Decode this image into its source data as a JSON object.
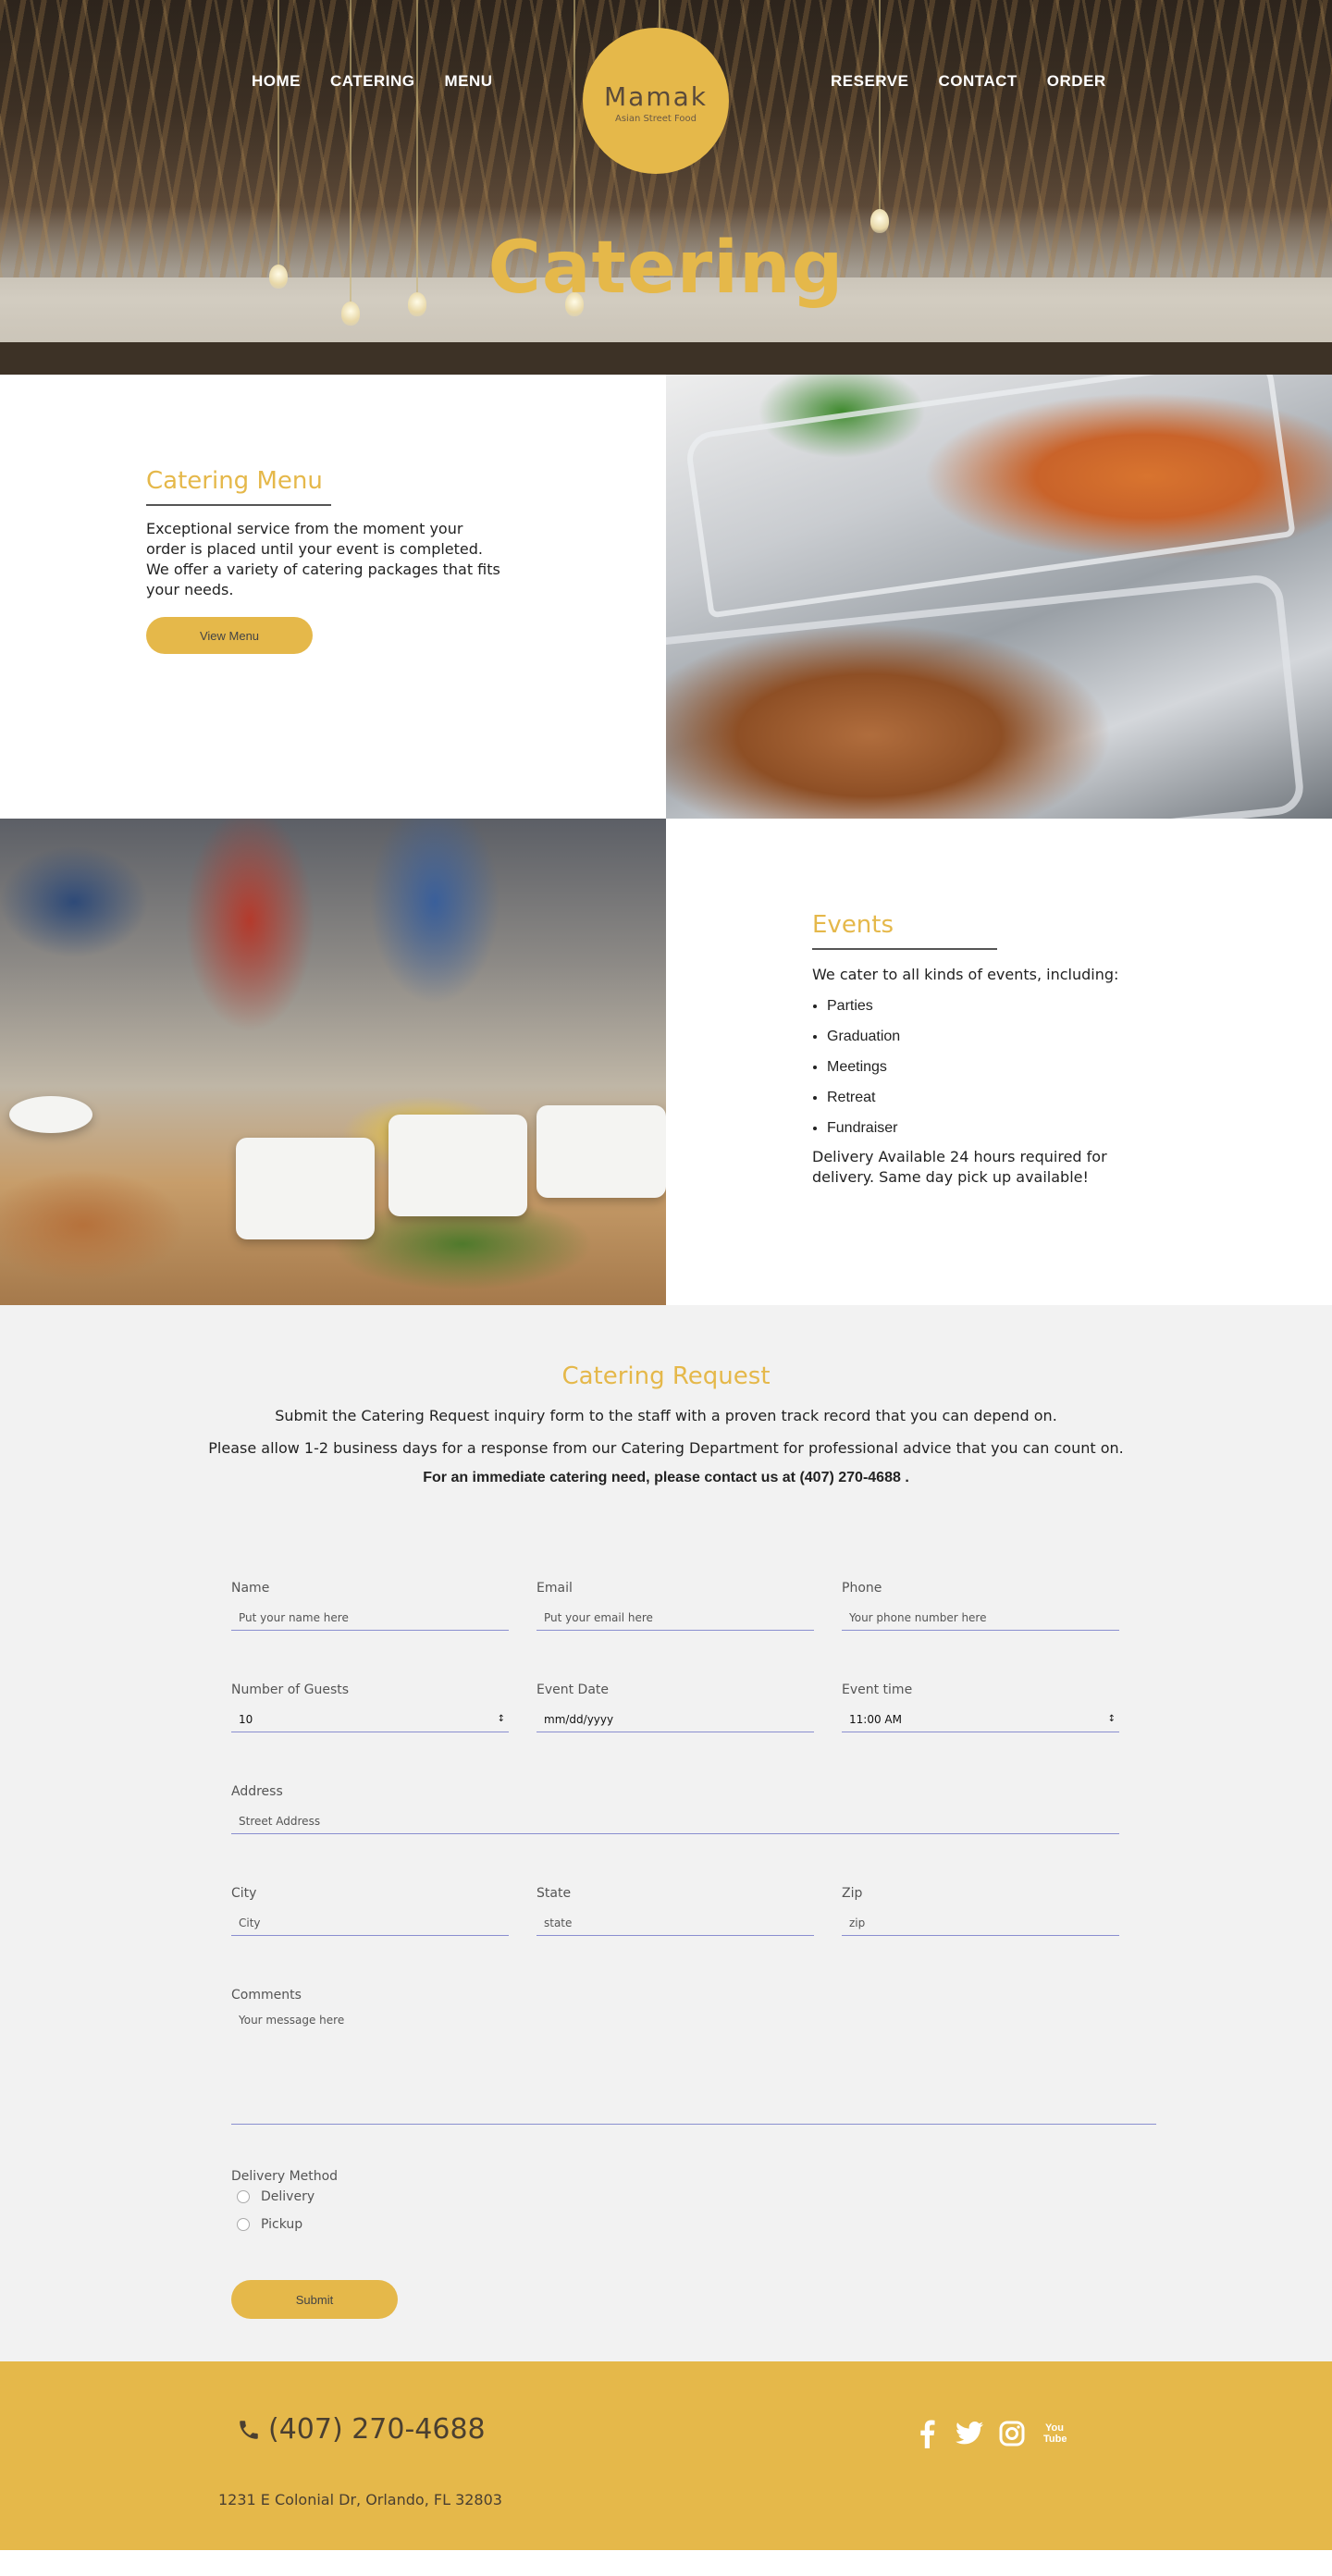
{
  "nav": {
    "left": [
      "HOME",
      "CATERING",
      "MENU"
    ],
    "right": [
      "RESERVE",
      "CONTACT",
      "ORDER"
    ]
  },
  "logo": {
    "name": "Mamak",
    "tagline": "Asian Street Food"
  },
  "hero": {
    "title": "Catering"
  },
  "catering_menu": {
    "heading": "Catering Menu",
    "body": "Exceptional service from the moment your order is placed until your event is completed. We offer a variety of catering packages that fits your needs.",
    "button": "View Menu"
  },
  "events": {
    "heading": "Events",
    "intro": "We cater to all kinds of events, including:",
    "items": [
      "Parties",
      "Graduation",
      "Meetings",
      "Retreat",
      "Fundraiser"
    ],
    "note": "Delivery Available 24 hours required for delivery. Same day pick up available!"
  },
  "request": {
    "heading": "Catering Request",
    "line1": "Submit the Catering Request inquiry form to the staff with a proven track record that you can depend on.",
    "line2": "Please allow 1-2 business days for a response from our Catering Department for professional advice that you can count on.",
    "line3": "For an immediate catering need, please contact us at (407) 270-4688 ."
  },
  "form": {
    "name": {
      "label": "Name",
      "placeholder": "Put your name here"
    },
    "email": {
      "label": "Email",
      "placeholder": "Put your email here"
    },
    "phone": {
      "label": "Phone",
      "placeholder": "Your phone number here"
    },
    "guests": {
      "label": "Number of Guests",
      "value": "10"
    },
    "event_date": {
      "label": "Event Date",
      "placeholder": "mm/dd/yyyy"
    },
    "event_time": {
      "label": "Event time",
      "value": "11:00 AM"
    },
    "address": {
      "label": "Address",
      "placeholder": "Street Address"
    },
    "city": {
      "label": "City",
      "placeholder": "City"
    },
    "state": {
      "label": "State",
      "placeholder": "state"
    },
    "zip": {
      "label": "Zip",
      "placeholder": "zip"
    },
    "comments": {
      "label": "Comments",
      "placeholder": "Your message here"
    },
    "delivery_method": {
      "label": "Delivery Method",
      "options": [
        "Delivery",
        "Pickup"
      ]
    },
    "submit": "Submit"
  },
  "footer": {
    "phone": "(407) 270-4688",
    "address": "1231 E Colonial Dr, Orlando, FL 32803",
    "socials": [
      "facebook-icon",
      "twitter-icon",
      "instagram-icon",
      "youtube-icon"
    ],
    "youtube_text": "You Tube"
  },
  "colors": {
    "accent": "#e5b84a",
    "form_bg": "#f2f2f2",
    "input_line": "#8a8fd0"
  }
}
